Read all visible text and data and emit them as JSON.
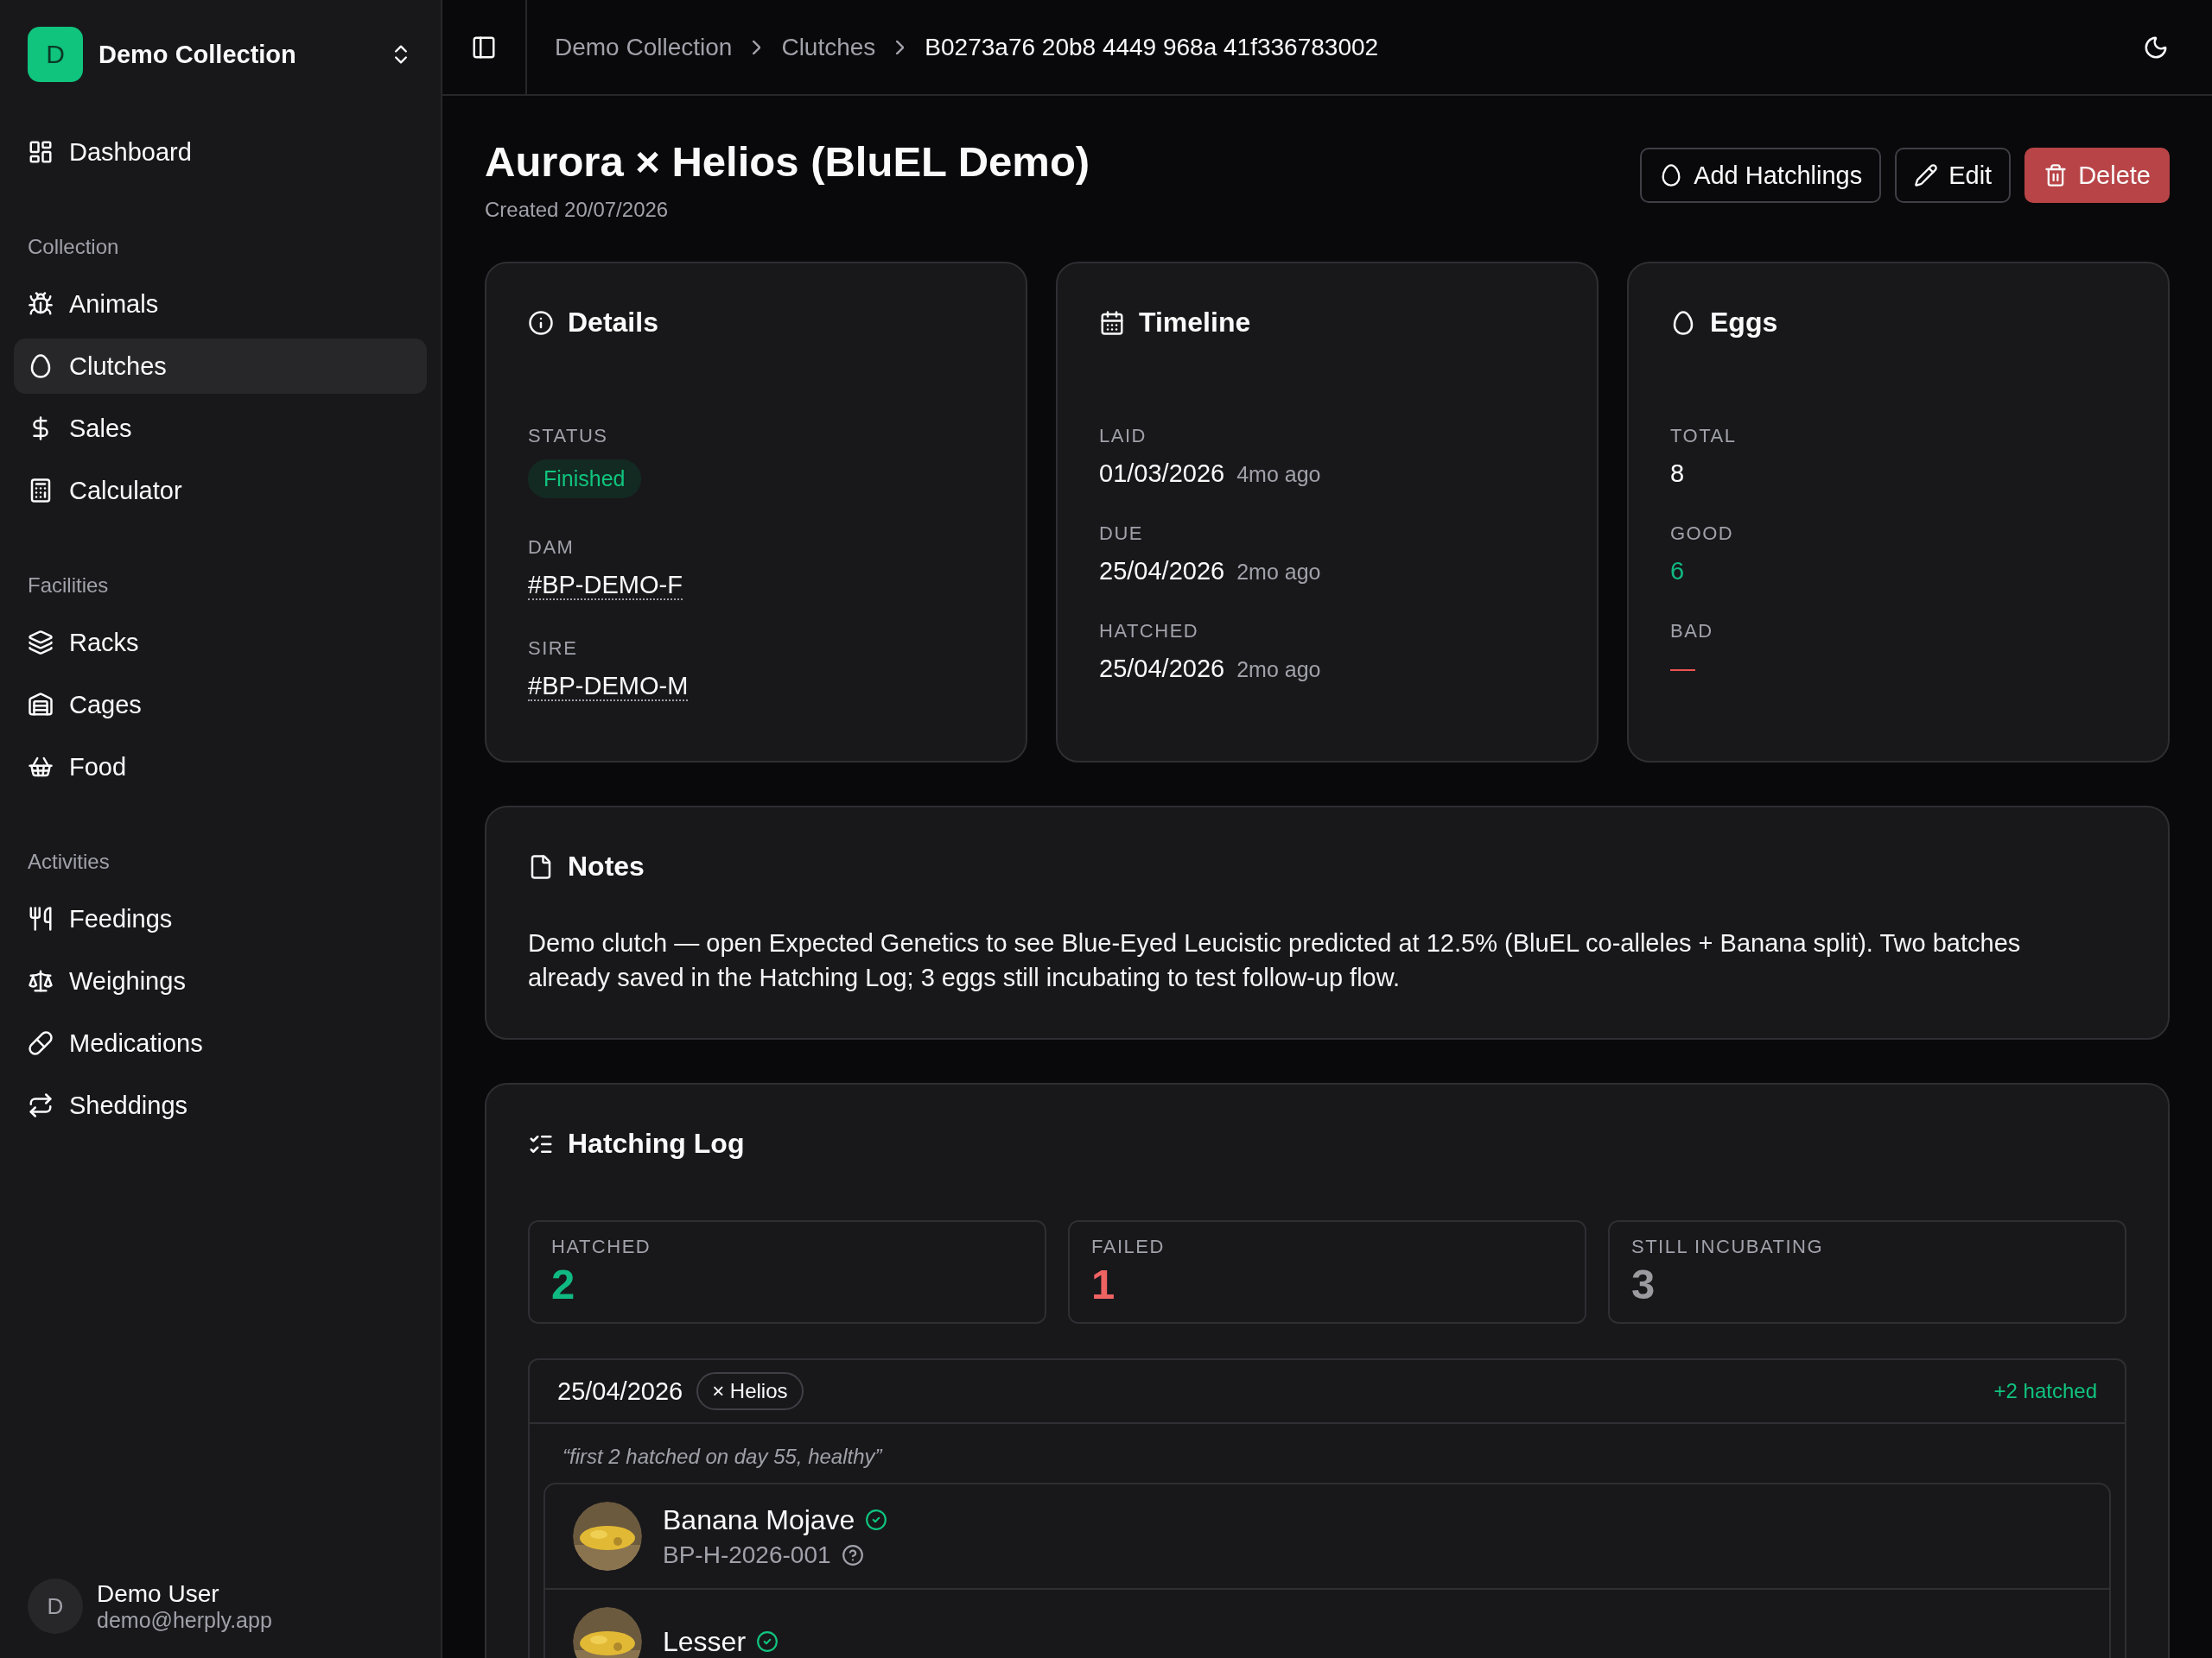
{
  "sidebar": {
    "collection": {
      "initial": "D",
      "name": "Demo Collection"
    },
    "top_items": [
      {
        "label": "Dashboard",
        "selected": false
      }
    ],
    "sections": [
      {
        "title": "Collection",
        "items": [
          {
            "label": "Animals",
            "selected": false
          },
          {
            "label": "Clutches",
            "selected": true
          },
          {
            "label": "Sales",
            "selected": false
          },
          {
            "label": "Calculator",
            "selected": false
          }
        ]
      },
      {
        "title": "Facilities",
        "items": [
          {
            "label": "Racks",
            "selected": false
          },
          {
            "label": "Cages",
            "selected": false
          },
          {
            "label": "Food",
            "selected": false
          }
        ]
      },
      {
        "title": "Activities",
        "items": [
          {
            "label": "Feedings",
            "selected": false
          },
          {
            "label": "Weighings",
            "selected": false
          },
          {
            "label": "Medications",
            "selected": false
          },
          {
            "label": "Sheddings",
            "selected": false
          }
        ]
      }
    ],
    "user": {
      "initial": "D",
      "name": "Demo User",
      "email": "demo@herply.app"
    }
  },
  "breadcrumbs": [
    "Demo Collection",
    "Clutches",
    "B0273a76 20b8 4449 968a 41f336783002"
  ],
  "page": {
    "title": "Aurora × Helios (BluEL Demo)",
    "created": "Created 20/07/2026",
    "actions": [
      {
        "label": "Add Hatchlings",
        "kind": "add"
      },
      {
        "label": "Edit",
        "kind": "edit"
      },
      {
        "label": "Delete",
        "kind": "delete"
      }
    ]
  },
  "details": {
    "title": "Details",
    "status_label": "STATUS",
    "status": "Finished",
    "dam_label": "DAM",
    "dam": "#BP-DEMO-F",
    "sire_label": "SIRE",
    "sire": "#BP-DEMO-M"
  },
  "timeline": {
    "title": "Timeline",
    "entries": [
      {
        "label": "LAID",
        "date": "01/03/2026",
        "relative": "4mo ago"
      },
      {
        "label": "DUE",
        "date": "25/04/2026",
        "relative": "2mo ago"
      },
      {
        "label": "HATCHED",
        "date": "25/04/2026",
        "relative": "2mo ago"
      }
    ]
  },
  "eggs": {
    "title": "Eggs",
    "entries": [
      {
        "label": "TOTAL",
        "value": "8",
        "color": "#ffffff"
      },
      {
        "label": "GOOD",
        "value": "6",
        "color": "#10b981"
      },
      {
        "label": "BAD",
        "value": "—",
        "color": "#ef5350"
      }
    ]
  },
  "notes": {
    "title": "Notes",
    "text": "Demo clutch — open Expected Genetics to see Blue-Eyed Leucistic predicted at 12.5% (BluEL co-alleles + Banana split). Two batches already saved in the Hatching Log; 3 eggs still incubating to test follow-up flow."
  },
  "hatching_log": {
    "title": "Hatching Log",
    "stats": [
      {
        "label": "HATCHED",
        "value": "2",
        "color": "#10b981"
      },
      {
        "label": "FAILED",
        "value": "1",
        "color": "#f06363"
      },
      {
        "label": "STILL INCUBATING",
        "value": "3",
        "color": "#9a9a9f"
      }
    ],
    "batches": [
      {
        "date": "25/04/2026",
        "sire": "× Helios",
        "count": "+2 hatched",
        "note": "“first 2 hatched on day 55, healthy”",
        "hatchlings": [
          {
            "name": "Banana Mojave",
            "id": "BP-H-2026-001",
            "verified": true,
            "kind": "picture"
          },
          {
            "name": "Lesser",
            "verified": true,
            "kind": "picture"
          }
        ]
      }
    ]
  }
}
